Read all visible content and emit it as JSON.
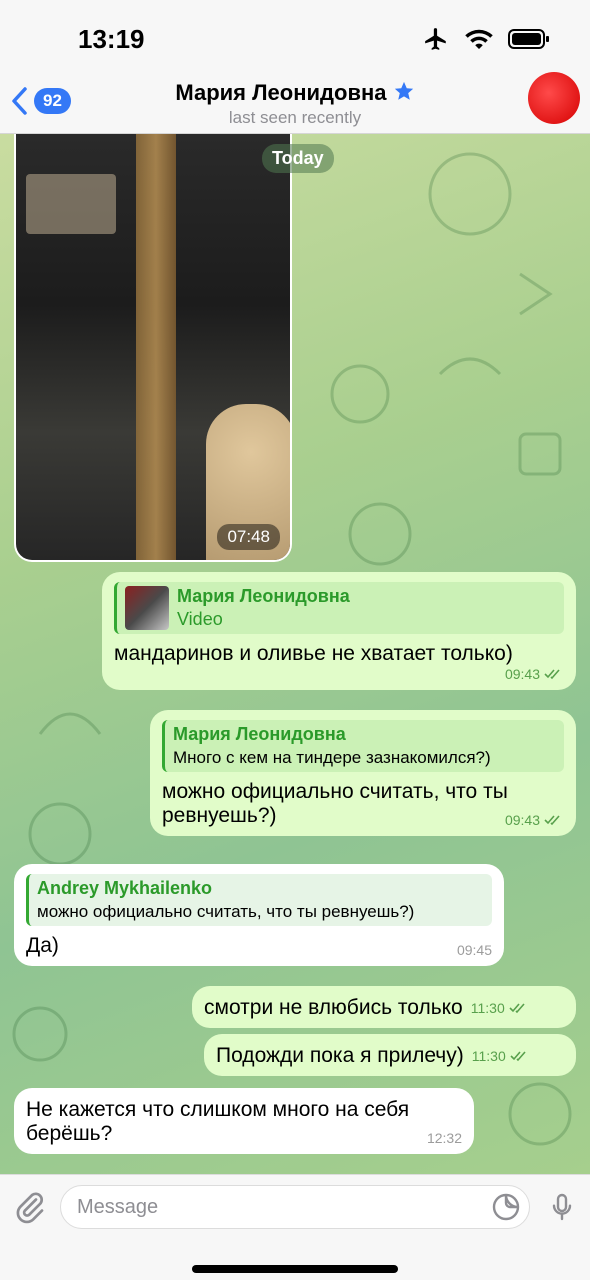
{
  "status": {
    "time": "13:19"
  },
  "header": {
    "back_count": "92",
    "title": "Мария Леонидовна",
    "subtitle": "last seen recently"
  },
  "chat": {
    "date_pill": "Today",
    "video": {
      "duration": "07:48"
    },
    "messages": [
      {
        "reply_name": "Мария Леонидовна",
        "reply_text": "Video",
        "text": "мандаринов и оливье не хватает только)",
        "time": "09:43"
      },
      {
        "reply_name": "Мария Леонидовна",
        "reply_text": "Много с кем на тиндере зазнакомился?)",
        "text_line1": "можно официально считать, что ты",
        "text_line2": "ревнуешь?)",
        "time": "09:43"
      },
      {
        "reply_name": "Andrey Mykhailenko",
        "reply_text": "можно официально считать, что ты ревнуешь?)",
        "text": "Да)",
        "time": "09:45"
      },
      {
        "text": "смотри не влюбись только",
        "time": "11:30"
      },
      {
        "text": "Подожди пока я прилечу)",
        "time": "11:30"
      },
      {
        "text_line1": "Не кажется что слишком много на себя",
        "text_line2": "берёшь?",
        "time": "12:32"
      }
    ]
  },
  "input": {
    "placeholder": "Message"
  },
  "colors": {
    "accent": "#3478f6",
    "outgoing": "#e1fcc9",
    "reply": "#2b9a2a"
  }
}
